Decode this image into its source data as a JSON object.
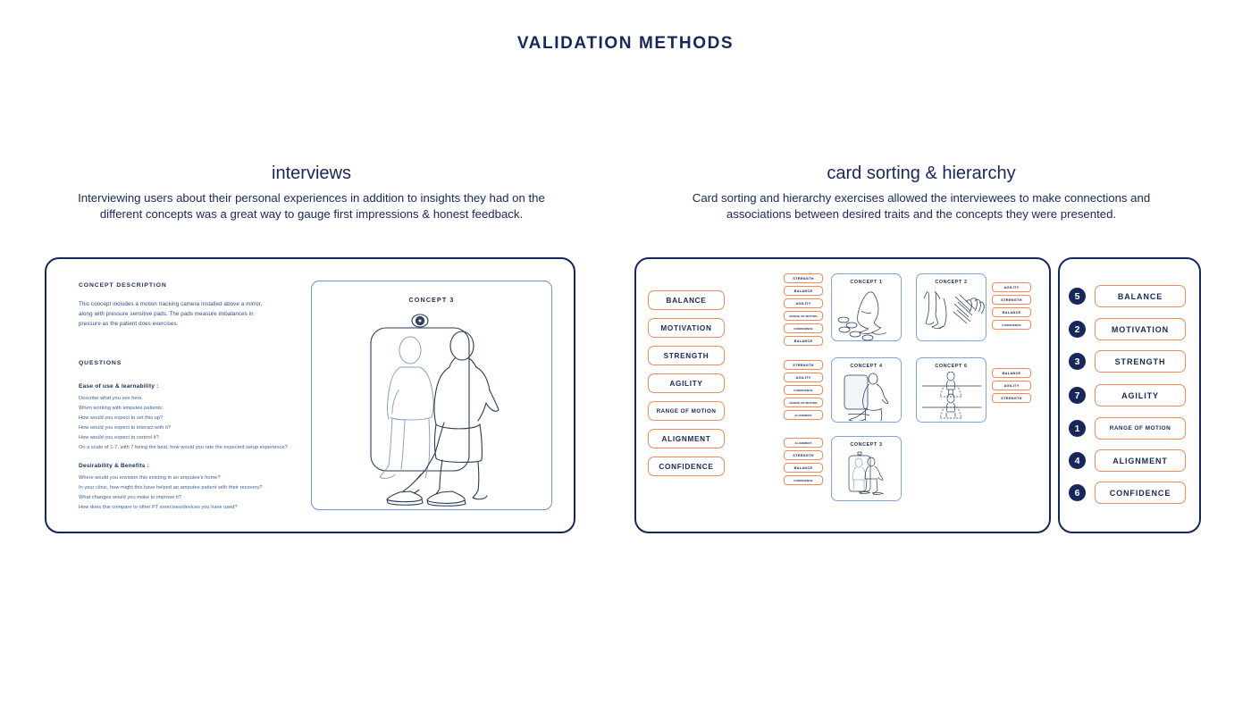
{
  "page": {
    "title": "VALIDATION METHODS",
    "accent_navy": "#17275c",
    "accent_orange": "#ef8a5a",
    "accent_blue": "#6b93d6"
  },
  "sections": [
    {
      "heading": "interviews",
      "description": "Interviewing users about their personal experiences in addition to insights they had on the different concepts was a great way to gauge first impressions & honest feedback."
    },
    {
      "heading": "card sorting & hierarchy",
      "description": "Card sorting and hierarchy exercises allowed the interviewees to make connections and associations between desired traits and the concepts they were presented."
    }
  ],
  "interview_panel": {
    "concept_description_label": "CONCEPT DESCRIPTION",
    "concept_description_body": "This concept includes a motion tracking camera installed above a mirror, along with pressure sensitive pads. The pads measure imbalances in pressure as the patient does exercises.",
    "questions_label": "QUESTIONS",
    "question_groups": [
      {
        "heading": "Ease of use & learnability :",
        "items": [
          "Describe what you see here.",
          "When working with amputee patients:",
          "How would you expect to set this up?",
          "How would you expect to interact with it?",
          "How would you expect to control it?",
          "On a scale of 1-7, with 7 being the best, how would you rate the expected setup experience?"
        ]
      },
      {
        "heading": "Desirability & Benefits :",
        "items": [
          "Where would you envision this existing in an amputee's home?",
          "In your clinic, how might this have helped an amputee patient with their recovery?",
          "What changes would you make to improve it?",
          "How does this compare to other PT exercises/devices you have used?"
        ]
      }
    ],
    "concept_image_title": "CONCEPT 3"
  },
  "card_sorting_panel": {
    "trait_cards": [
      "BALANCE",
      "MOTIVATION",
      "STRENGTH",
      "AGILITY",
      "RANGE OF MOTION",
      "ALIGNMENT",
      "CONFIDENCE"
    ],
    "concepts": [
      {
        "title": "CONCEPT 1",
        "tags": [
          "STRENGTH",
          "BALANCE",
          "AGILITY",
          "RANGE OF MOTION",
          "CONFIDENCE",
          "BALANCE"
        ]
      },
      {
        "title": "CONCEPT 2",
        "tags": [
          "AGILITY",
          "STRENGTH",
          "BALANCE",
          "CONFIDENCE"
        ]
      },
      {
        "title": "CONCEPT 4",
        "tags": [
          "STRENGTH",
          "AGILITY",
          "CONFIDENCE",
          "RANGE OF MOTION",
          "ALIGNMENT"
        ]
      },
      {
        "title": "CONCEPT 6",
        "tags": [
          "BALANCE",
          "AGILITY",
          "STRENGTH"
        ]
      },
      {
        "title": "CONCEPT 3",
        "tags": [
          "ALIGNMENT",
          "STRENGTH",
          "BALANCE",
          "CONFIDENCE"
        ]
      }
    ]
  },
  "hierarchy_panel": {
    "ranked_traits": [
      {
        "rank": "5",
        "label": "BALANCE"
      },
      {
        "rank": "2",
        "label": "MOTIVATION"
      },
      {
        "rank": "3",
        "label": "STRENGTH"
      },
      {
        "rank": "7",
        "label": "AGILITY"
      },
      {
        "rank": "1",
        "label": "RANGE OF MOTION"
      },
      {
        "rank": "4",
        "label": "ALIGNMENT"
      },
      {
        "rank": "6",
        "label": "CONFIDENCE"
      }
    ]
  }
}
